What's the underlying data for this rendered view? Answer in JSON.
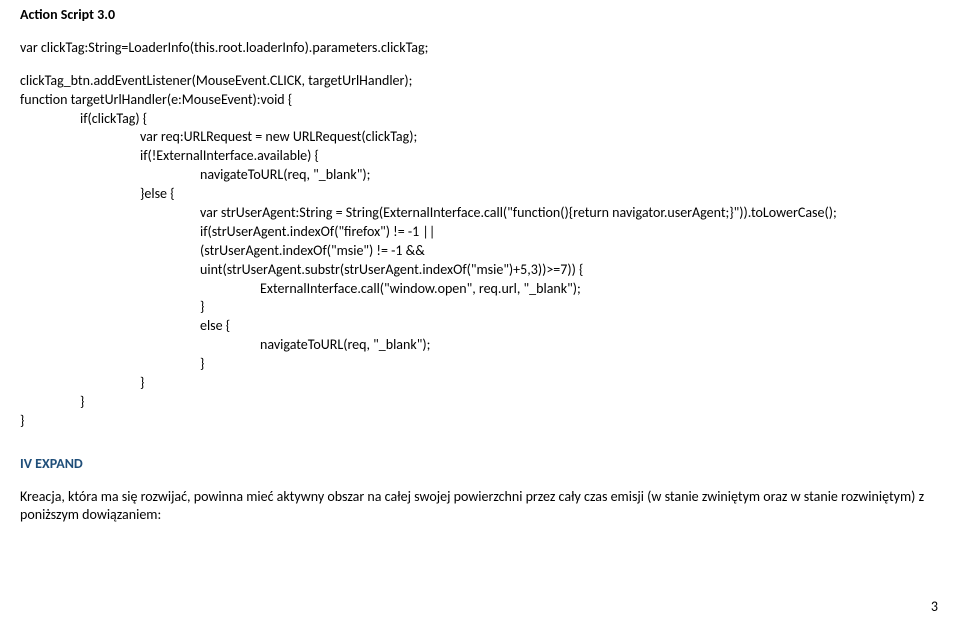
{
  "heading": "Action Script 3.0",
  "code": {
    "l1": "var clickTag:String=LoaderInfo(this.root.loaderInfo).parameters.clickTag;",
    "l2": "clickTag_btn.addEventListener(MouseEvent.CLICK, targetUrlHandler);",
    "l3": "function targetUrlHandler(e:MouseEvent):void {",
    "l4": "if(clickTag) {",
    "l5": "var req:URLRequest = new URLRequest(clickTag);",
    "l6": "if(!ExternalInterface.available) {",
    "l7": "navigateToURL(req, \"_blank\");",
    "l8": "}else {",
    "l9": "var strUserAgent:String = String(ExternalInterface.call(\"function(){return navigator.userAgent;}\")).toLowerCase();",
    "l10": "if(strUserAgent.indexOf(\"firefox\") != -1 ||",
    "l11": "(strUserAgent.indexOf(\"msie\") != -1 &&",
    "l12": "uint(strUserAgent.substr(strUserAgent.indexOf(\"msie\")+5,3))>=7)) {",
    "l13": "ExternalInterface.call(\"window.open\", req.url, \"_blank\");",
    "l14": "}",
    "l15": "else {",
    "l16": "navigateToURL(req, \"_blank\");",
    "l17": "}",
    "l18": "}",
    "l19": "}",
    "l20": "}"
  },
  "section_title": "IV EXPAND",
  "paragraph": "Kreacja, która ma się rozwijać, powinna mieć aktywny obszar na całej swojej powierzchni przez cały czas emisji (w stanie zwiniętym oraz w stanie rozwiniętym) z poniższym dowiązaniem:",
  "page_number": "3"
}
